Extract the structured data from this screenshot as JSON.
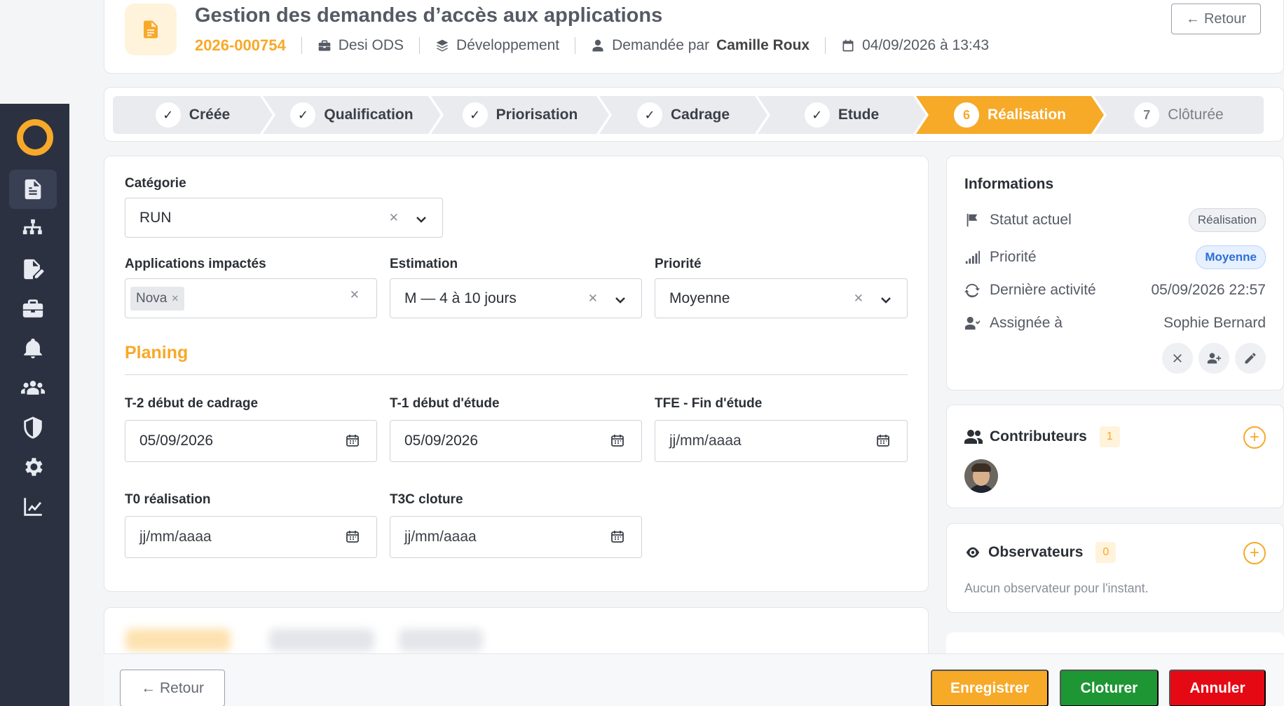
{
  "header": {
    "title": "Gestion des demandes d’accès aux applications",
    "reference": "2026-000754",
    "application": "Desi ODS",
    "environment": "Développement",
    "requested_by_prefix": "Demandée par",
    "requested_by_name": "Camille Roux",
    "date": "04/09/2026 à 13:43",
    "back_label": "Retour"
  },
  "stepper": {
    "steps": [
      {
        "label": "Créée",
        "state": "done"
      },
      {
        "label": "Qualification",
        "state": "done"
      },
      {
        "label": "Priorisation",
        "state": "done"
      },
      {
        "label": "Cadrage",
        "state": "done"
      },
      {
        "label": "Etude",
        "state": "done"
      },
      {
        "label": "Réalisation",
        "number": "6",
        "state": "active"
      },
      {
        "label": "Clôturée",
        "number": "7",
        "state": "pending"
      }
    ]
  },
  "form": {
    "category_label": "Catégorie",
    "category_value": "RUN",
    "apps_label": "Applications impactés",
    "apps_tags": [
      "Nova"
    ],
    "estimation_label": "Estimation",
    "estimation_value": "M — 4 à 10 jours",
    "priority_label": "Priorité",
    "priority_value": "Moyenne",
    "planning_title": "Planing",
    "t2_label": "T-2 début de cadrage",
    "t2_value": "05/09/2026",
    "t1_label": "T-1 début d'étude",
    "t1_value": "05/09/2026",
    "tfe_label": "TFE - Fin d'étude",
    "tfe_value": "jj/mm/aaaa",
    "t0_label": "T0 réalisation",
    "t0_value": "jj/mm/aaaa",
    "t3c_label": "T3C cloture",
    "t3c_value": "jj/mm/aaaa"
  },
  "info": {
    "title": "Informations",
    "status_label": "Statut actuel",
    "status_value": "Réalisation",
    "priority_label": "Priorité",
    "priority_value": "Moyenne",
    "activity_label": "Dernière activité",
    "activity_value": "05/09/2026 22:57",
    "assignee_label": "Assignée à",
    "assignee_value": "Sophie Bernard"
  },
  "contributors": {
    "title": "Contributeurs",
    "count": "1"
  },
  "observers": {
    "title": "Observateurs",
    "count": "0",
    "empty_text": "Aucun observateur pour l'instant."
  },
  "footer": {
    "back_label": "Retour",
    "save_label": "Enregistrer",
    "close_label": "Cloturer",
    "cancel_label": "Annuler"
  },
  "colors": {
    "accent": "#f7a928",
    "sidebar": "#2c3142",
    "success": "#1d9633",
    "danger": "#e50914"
  }
}
